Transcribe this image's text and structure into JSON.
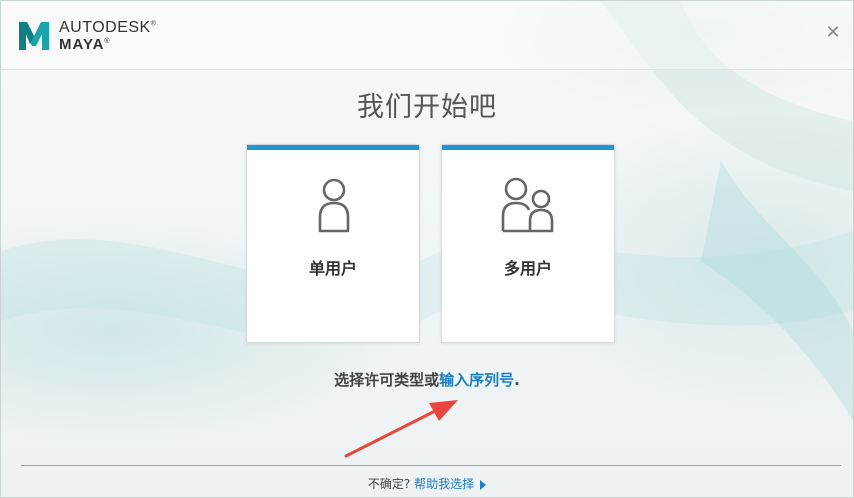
{
  "header": {
    "brand_line1": "AUTODESK",
    "brand_line2": "MAYA",
    "brand_mark": "®",
    "close_icon": "close-icon"
  },
  "main": {
    "title": "我们开始吧",
    "cards": [
      {
        "label": "单用户",
        "icon": "single-user-icon"
      },
      {
        "label": "多用户",
        "icon": "multi-user-icon"
      }
    ],
    "license_prompt": "选择许可类型或",
    "license_link": "输入序列号",
    "license_suffix": "."
  },
  "footer": {
    "unsure": "不确定?",
    "help_link": "帮助我选择"
  },
  "colors": {
    "accent": "#1f95d3",
    "link": "#1a7fc1",
    "annotation_arrow": "#e8463e"
  }
}
